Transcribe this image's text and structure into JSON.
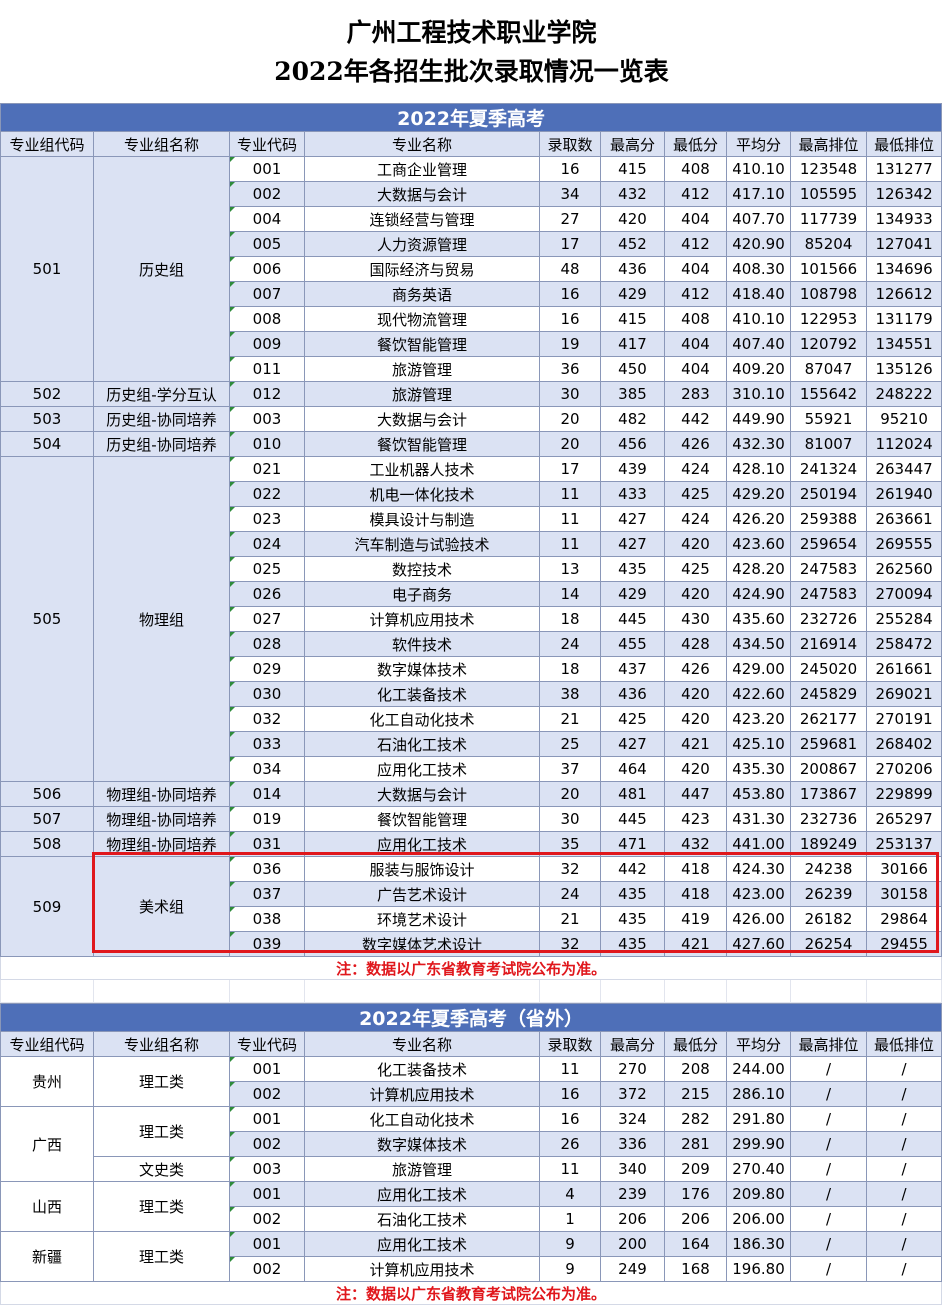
{
  "title_line1": "广州工程技术职业学院",
  "title_line2": "2022年各招生批次录取情况一览表",
  "columns": [
    "专业组代码",
    "专业组名称",
    "专业代码",
    "专业名称",
    "录取数",
    "最高分",
    "最低分",
    "平均分",
    "最高排位",
    "最低排位"
  ],
  "note": "注：数据以广东省教育考试院公布为准。",
  "section1": {
    "banner": "2022年夏季高考",
    "groups": [
      {
        "code": "501",
        "name": "历史组",
        "rows": [
          [
            "001",
            "工商企业管理",
            "16",
            "415",
            "408",
            "410.10",
            "123548",
            "131277"
          ],
          [
            "002",
            "大数据与会计",
            "34",
            "432",
            "412",
            "417.10",
            "105595",
            "126342"
          ],
          [
            "004",
            "连锁经营与管理",
            "27",
            "420",
            "404",
            "407.70",
            "117739",
            "134933"
          ],
          [
            "005",
            "人力资源管理",
            "17",
            "452",
            "412",
            "420.90",
            "85204",
            "127041"
          ],
          [
            "006",
            "国际经济与贸易",
            "48",
            "436",
            "404",
            "408.30",
            "101566",
            "134696"
          ],
          [
            "007",
            "商务英语",
            "16",
            "429",
            "412",
            "418.40",
            "108798",
            "126612"
          ],
          [
            "008",
            "现代物流管理",
            "16",
            "415",
            "408",
            "410.10",
            "122953",
            "131179"
          ],
          [
            "009",
            "餐饮智能管理",
            "19",
            "417",
            "404",
            "407.40",
            "120792",
            "134551"
          ],
          [
            "011",
            "旅游管理",
            "36",
            "450",
            "404",
            "409.20",
            "87047",
            "135126"
          ]
        ]
      },
      {
        "code": "502",
        "name": "历史组-学分互认",
        "rows": [
          [
            "012",
            "旅游管理",
            "30",
            "385",
            "283",
            "310.10",
            "155642",
            "248222"
          ]
        ]
      },
      {
        "code": "503",
        "name": "历史组-协同培养",
        "rows": [
          [
            "003",
            "大数据与会计",
            "20",
            "482",
            "442",
            "449.90",
            "55921",
            "95210"
          ]
        ]
      },
      {
        "code": "504",
        "name": "历史组-协同培养",
        "rows": [
          [
            "010",
            "餐饮智能管理",
            "20",
            "456",
            "426",
            "432.30",
            "81007",
            "112024"
          ]
        ]
      },
      {
        "code": "505",
        "name": "物理组",
        "rows": [
          [
            "021",
            "工业机器人技术",
            "17",
            "439",
            "424",
            "428.10",
            "241324",
            "263447"
          ],
          [
            "022",
            "机电一体化技术",
            "11",
            "433",
            "425",
            "429.20",
            "250194",
            "261940"
          ],
          [
            "023",
            "模具设计与制造",
            "11",
            "427",
            "424",
            "426.20",
            "259388",
            "263661"
          ],
          [
            "024",
            "汽车制造与试验技术",
            "11",
            "427",
            "420",
            "423.60",
            "259654",
            "269555"
          ],
          [
            "025",
            "数控技术",
            "13",
            "435",
            "425",
            "428.20",
            "247583",
            "262560"
          ],
          [
            "026",
            "电子商务",
            "14",
            "429",
            "420",
            "424.90",
            "247583",
            "270094"
          ],
          [
            "027",
            "计算机应用技术",
            "18",
            "445",
            "430",
            "435.60",
            "232726",
            "255284"
          ],
          [
            "028",
            "软件技术",
            "24",
            "455",
            "428",
            "434.50",
            "216914",
            "258472"
          ],
          [
            "029",
            "数字媒体技术",
            "18",
            "437",
            "426",
            "429.00",
            "245020",
            "261661"
          ],
          [
            "030",
            "化工装备技术",
            "38",
            "436",
            "420",
            "422.60",
            "245829",
            "269021"
          ],
          [
            "032",
            "化工自动化技术",
            "21",
            "425",
            "420",
            "423.20",
            "262177",
            "270191"
          ],
          [
            "033",
            "石油化工技术",
            "25",
            "427",
            "421",
            "425.10",
            "259681",
            "268402"
          ],
          [
            "034",
            "应用化工技术",
            "37",
            "464",
            "420",
            "435.30",
            "200867",
            "270206"
          ]
        ]
      },
      {
        "code": "506",
        "name": "物理组-协同培养",
        "rows": [
          [
            "014",
            "大数据与会计",
            "20",
            "481",
            "447",
            "453.80",
            "173867",
            "229899"
          ]
        ]
      },
      {
        "code": "507",
        "name": "物理组-协同培养",
        "rows": [
          [
            "019",
            "餐饮智能管理",
            "30",
            "445",
            "423",
            "431.30",
            "232736",
            "265297"
          ]
        ]
      },
      {
        "code": "508",
        "name": "物理组-协同培养",
        "rows": [
          [
            "031",
            "应用化工技术",
            "35",
            "471",
            "432",
            "441.00",
            "189249",
            "253137"
          ]
        ]
      },
      {
        "code": "509",
        "name": "美术组",
        "rows": [
          [
            "036",
            "服装与服饰设计",
            "32",
            "442",
            "418",
            "424.30",
            "24238",
            "30166"
          ],
          [
            "037",
            "广告艺术设计",
            "24",
            "435",
            "418",
            "423.00",
            "26239",
            "30158"
          ],
          [
            "038",
            "环境艺术设计",
            "21",
            "435",
            "419",
            "426.00",
            "26182",
            "29864"
          ],
          [
            "039",
            "数字媒体艺术设计",
            "32",
            "435",
            "421",
            "427.60",
            "26254",
            "29455"
          ]
        ]
      }
    ]
  },
  "section2": {
    "banner": "2022年夏季高考（省外）",
    "provinces": [
      {
        "name": "贵州",
        "subgroups": [
          {
            "name": "理工类",
            "rows": [
              [
                "001",
                "化工装备技术",
                "11",
                "270",
                "208",
                "244.00",
                "/",
                "/"
              ],
              [
                "002",
                "计算机应用技术",
                "16",
                "372",
                "215",
                "286.10",
                "/",
                "/"
              ]
            ]
          }
        ]
      },
      {
        "name": "广西",
        "subgroups": [
          {
            "name": "理工类",
            "rows": [
              [
                "001",
                "化工自动化技术",
                "16",
                "324",
                "282",
                "291.80",
                "/",
                "/"
              ],
              [
                "002",
                "数字媒体技术",
                "26",
                "336",
                "281",
                "299.90",
                "/",
                "/"
              ]
            ]
          },
          {
            "name": "文史类",
            "rows": [
              [
                "003",
                "旅游管理",
                "11",
                "340",
                "209",
                "270.40",
                "/",
                "/"
              ]
            ]
          }
        ]
      },
      {
        "name": "山西",
        "subgroups": [
          {
            "name": "理工类",
            "rows": [
              [
                "001",
                "应用化工技术",
                "4",
                "239",
                "176",
                "209.80",
                "/",
                "/"
              ],
              [
                "002",
                "石油化工技术",
                "1",
                "206",
                "206",
                "206.00",
                "/",
                "/"
              ]
            ]
          }
        ]
      },
      {
        "name": "新疆",
        "subgroups": [
          {
            "name": "理工类",
            "rows": [
              [
                "001",
                "应用化工技术",
                "9",
                "200",
                "164",
                "186.30",
                "/",
                "/"
              ],
              [
                "002",
                "计算机应用技术",
                "9",
                "249",
                "168",
                "196.80",
                "/",
                "/"
              ]
            ]
          }
        ]
      }
    ]
  }
}
